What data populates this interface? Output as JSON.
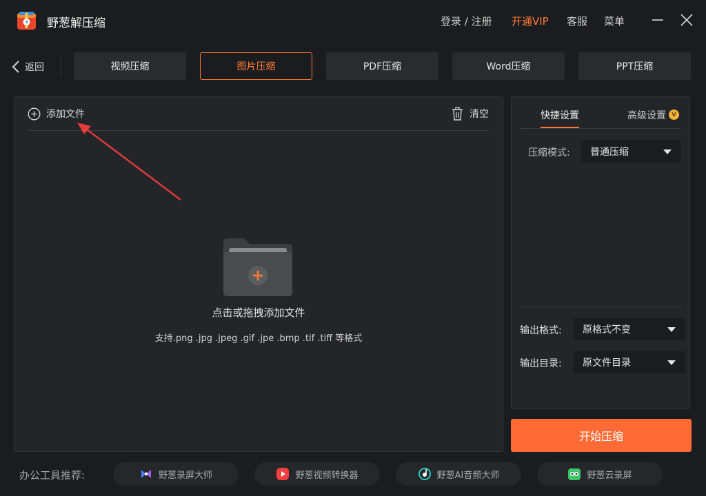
{
  "app": {
    "title": "野葱解压缩"
  },
  "topbar": {
    "login": "登录 / 注册",
    "vip": "开通VIP",
    "service": "客服",
    "menu": "菜单"
  },
  "nav": {
    "back": "返回",
    "tabs": [
      {
        "label": "视频压缩",
        "active": false
      },
      {
        "label": "图片压缩",
        "active": true
      },
      {
        "label": "PDF压缩",
        "active": false
      },
      {
        "label": "Word压缩",
        "active": false
      },
      {
        "label": "PPT压缩",
        "active": false
      }
    ]
  },
  "file_panel": {
    "add_label": "添加文件",
    "clear_label": "清空",
    "drop_title": "点击或拖拽添加文件",
    "drop_subtitle": "支持.png .jpg .jpeg .gif .jpe .bmp .tif .tiff 等格式"
  },
  "settings": {
    "tabs": [
      "快捷设置",
      "高级设置"
    ],
    "mode_label": "压缩模式:",
    "mode_value": "普通压缩",
    "format_label": "输出格式:",
    "format_value": "原格式不变",
    "dir_label": "输出目录:",
    "dir_value": "原文件目录"
  },
  "actions": {
    "start": "开始压缩"
  },
  "footer": {
    "label": "办公工具推荐:",
    "tools": [
      {
        "name": "野葱录屏大师",
        "icon": "screen-recorder-icon"
      },
      {
        "name": "野葱视频转换器",
        "icon": "video-converter-icon"
      },
      {
        "name": "野葱AI音频大师",
        "icon": "audio-master-icon"
      },
      {
        "name": "野葱云录屏",
        "icon": "cloud-recorder-icon"
      }
    ]
  },
  "colors": {
    "accent": "#ff6a35",
    "background": "#1b1c1f",
    "panel": "#242528"
  }
}
